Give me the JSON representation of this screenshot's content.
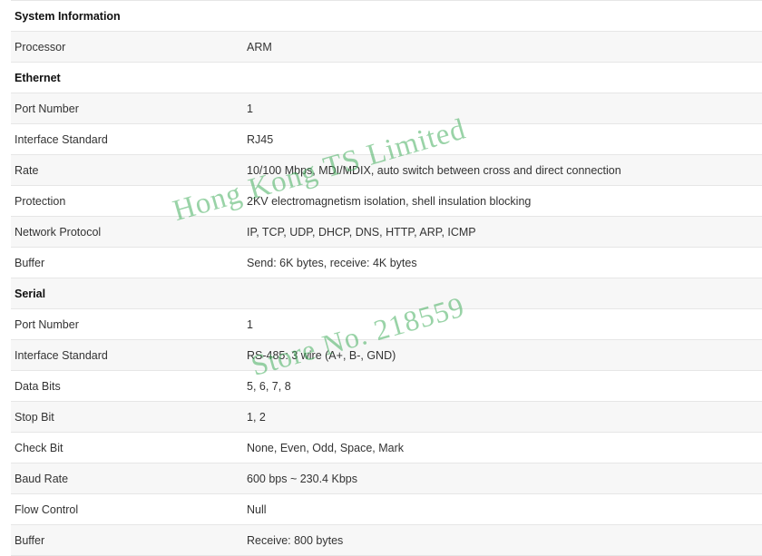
{
  "rows": [
    {
      "type": "section",
      "label": "System Information"
    },
    {
      "label": "Processor",
      "value": "ARM"
    },
    {
      "type": "section",
      "label": "Ethernet"
    },
    {
      "label": "Port Number",
      "value": "1"
    },
    {
      "label": "Interface Standard",
      "value": "RJ45"
    },
    {
      "label": "Rate",
      "value": "10/100 Mbps, MDI/MDIX, auto switch between cross and direct connection"
    },
    {
      "label": "Protection",
      "value": "2KV electromagnetism isolation, shell insulation blocking"
    },
    {
      "label": "Network Protocol",
      "value": "IP, TCP, UDP, DHCP, DNS, HTTP, ARP, ICMP"
    },
    {
      "label": "Buffer",
      "value": "Send: 6K bytes, receive: 4K bytes"
    },
    {
      "type": "section",
      "label": "Serial"
    },
    {
      "label": "Port Number",
      "value": "1"
    },
    {
      "label": "Interface Standard",
      "value": "RS-485: 3 wire (A+, B-, GND)"
    },
    {
      "label": "Data Bits",
      "value": "5, 6, 7, 8"
    },
    {
      "label": "Stop Bit",
      "value": "1, 2"
    },
    {
      "label": "Check Bit",
      "value": "None, Even, Odd, Space, Mark"
    },
    {
      "label": "Baud Rate",
      "value": "600 bps ~ 230.4 Kbps"
    },
    {
      "label": "Flow Control",
      "value": "Null"
    },
    {
      "label": "Buffer",
      "value": "Receive: 800 bytes"
    }
  ],
  "watermark": {
    "line1": "Hong Kong TS Limited",
    "line2": "Store No. 218559",
    "color": "#46af5f"
  }
}
